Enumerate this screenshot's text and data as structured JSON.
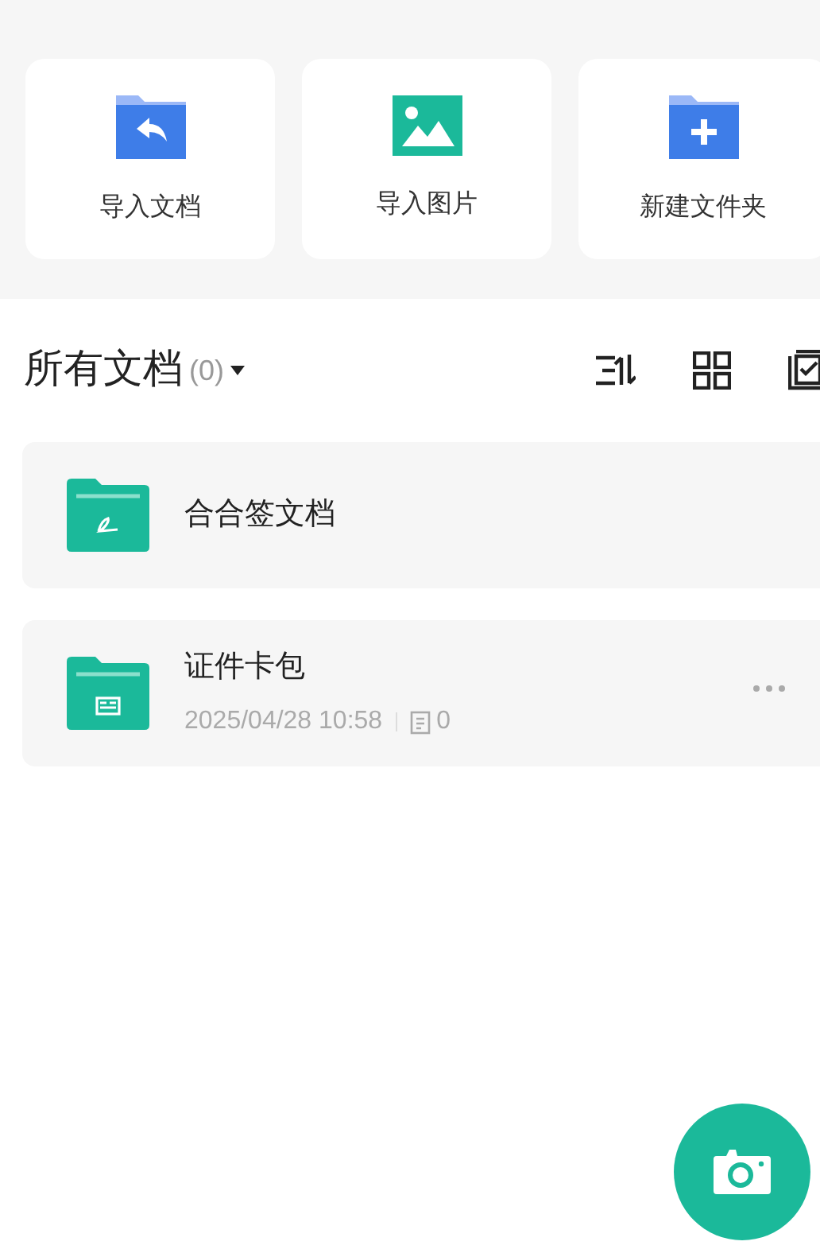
{
  "actions": [
    {
      "label": "导入文档",
      "kind": "import-doc"
    },
    {
      "label": "导入图片",
      "kind": "import-image"
    },
    {
      "label": "新建文件夹",
      "kind": "new-folder"
    }
  ],
  "list_header": {
    "title": "所有文档",
    "count": "(0)"
  },
  "folders": [
    {
      "name": "合合签文档",
      "kind": "signature"
    },
    {
      "name": "证件卡包",
      "kind": "card",
      "date": "2025/04/28 10:58",
      "files": "0"
    }
  ]
}
